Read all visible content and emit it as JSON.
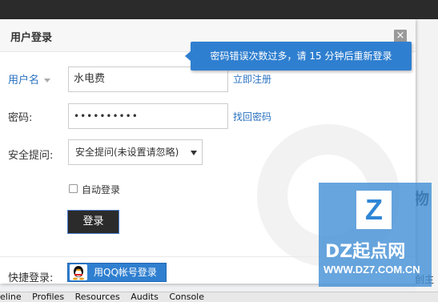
{
  "dialog": {
    "title": "用户登录",
    "close_label": "×"
  },
  "form": {
    "username_label": "用户名",
    "username_value": "水电费",
    "register_link": "立即注册",
    "password_label": "密码:",
    "password_mask": "••••••••••",
    "forgot_link": "找回密码",
    "question_label": "安全提问:",
    "question_selected": "安全提问(未设置请忽略)",
    "autologin_label": "自动登录",
    "login_button": "登录",
    "quick_label": "快捷登录:",
    "qq_button": "用QQ帐号登录"
  },
  "tooltip": {
    "text": "密码错误次数过多，请 15 分钟后重新登录"
  },
  "devtools": {
    "tabs": [
      "eline",
      "Profiles",
      "Resources",
      "Audits",
      "Console"
    ]
  },
  "watermark": {
    "box": "Z",
    "cn": "DZ起点网",
    "url": "WWW.DZ7.COM.CN"
  },
  "page": {
    "side_char": "物",
    "side_fragment": "创主"
  },
  "colors": {
    "accent": "#2f7fd0",
    "link": "#2a72c0",
    "button_dark": "#2b2b2b"
  }
}
